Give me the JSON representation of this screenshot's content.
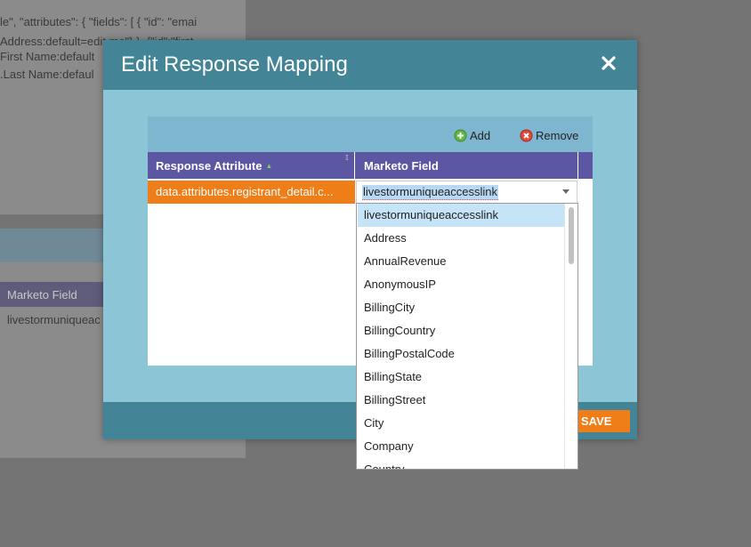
{
  "background": {
    "code_lines": [
      "le\", \"attributes\": { \"fields\": [ { \"id\": \"emai",
      " Address:default=edit me\"} }, {\"id\":\"first",
      "First Name:default",
      ".Last Name:defaul"
    ],
    "mapping_header": "Marketo Field",
    "mapping_value": "livestormuniqueac"
  },
  "modal": {
    "title": "Edit Response Mapping",
    "close_icon": "close-x-icon",
    "toolbar": {
      "add_label": "Add",
      "remove_label": "Remove"
    },
    "columns": {
      "response_attribute": "Response Attribute",
      "marketo_field": "Marketo Field"
    },
    "row": {
      "response_attribute": "data.attributes.registrant_detail.c...",
      "marketo_field": "livestormuniqueaccesslink"
    },
    "save_label": "SAVE"
  },
  "dropdown": {
    "selected": "livestormuniqueaccesslink",
    "options": [
      "livestormuniqueaccesslink",
      "Address",
      "AnnualRevenue",
      "AnonymousIP",
      "BillingCity",
      "BillingCountry",
      "BillingPostalCode",
      "BillingState",
      "BillingStreet",
      "City",
      "Company",
      "Country"
    ]
  },
  "colors": {
    "accent_orange": "#ef7d18",
    "header_purple": "#5b57a3",
    "titlebar_teal": "#438597",
    "modal_body": "#8cc6d6"
  }
}
